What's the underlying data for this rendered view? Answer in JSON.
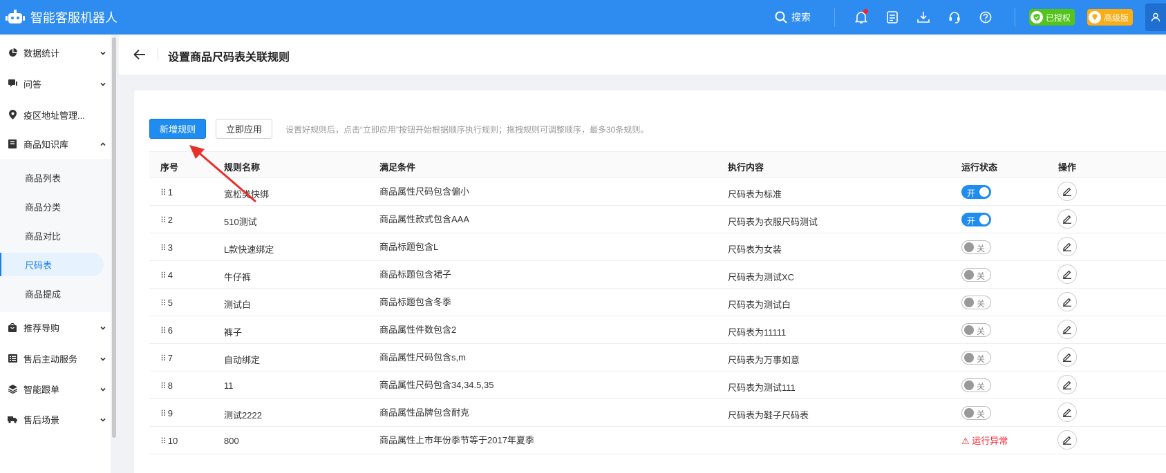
{
  "app": {
    "title": "智能客服机器人"
  },
  "topbar": {
    "search_label": "搜索",
    "authorized_label": "已授权",
    "edition_label": "高级版"
  },
  "sidebar": {
    "items": [
      {
        "label": "数据统计",
        "icon": "pie-chart-icon"
      },
      {
        "label": "问答",
        "icon": "chat-icon"
      },
      {
        "label": "疫区地址管理...",
        "icon": "location-icon"
      },
      {
        "label": "商品知识库",
        "icon": "book-icon"
      },
      {
        "label": "推荐导购",
        "icon": "bag-icon"
      },
      {
        "label": "售后主动服务",
        "icon": "list-icon"
      },
      {
        "label": "智能跟单",
        "icon": "layers-icon"
      },
      {
        "label": "售后场景",
        "icon": "truck-icon"
      }
    ],
    "sub_items": [
      {
        "label": "商品列表"
      },
      {
        "label": "商品分类"
      },
      {
        "label": "商品对比"
      },
      {
        "label": "尺码表"
      },
      {
        "label": "商品提成"
      }
    ],
    "active_sub": "尺码表"
  },
  "page": {
    "title": "设置商品尺码表关联规则",
    "add_button": "新增规则",
    "apply_button": "立即应用",
    "tip": "设置好规则后，点击“立即应用”按钮开始根据顺序执行规则；拖拽规则可调整顺序，最多30条规则。"
  },
  "table": {
    "columns": [
      "序号",
      "规则名称",
      "满足条件",
      "执行内容",
      "运行状态",
      "操作"
    ],
    "rows": [
      {
        "idx": "1",
        "name": "宽松类快绑",
        "cond": "商品属性尺码包含偏小",
        "exec": "尺码表为标准",
        "status": "开",
        "on": true
      },
      {
        "idx": "2",
        "name": "510测试",
        "cond": "商品属性款式包含AAA",
        "exec": "尺码表为衣服尺码测试",
        "status": "开",
        "on": true
      },
      {
        "idx": "3",
        "name": "L款快速绑定",
        "cond": "商品标题包含L",
        "exec": "尺码表为女装",
        "status": "关",
        "on": false
      },
      {
        "idx": "4",
        "name": "牛仔裤",
        "cond": "商品标题包含裙子",
        "exec": "尺码表为测试XC",
        "status": "关",
        "on": false
      },
      {
        "idx": "5",
        "name": "测试白",
        "cond": "商品标题包含冬季",
        "exec": "尺码表为测试白",
        "status": "关",
        "on": false
      },
      {
        "idx": "6",
        "name": "裤子",
        "cond": "商品属性件数包含2",
        "exec": "尺码表为11111",
        "status": "关",
        "on": false
      },
      {
        "idx": "7",
        "name": "自动绑定",
        "cond": "商品属性尺码包含s,m",
        "exec": "尺码表为万事如意",
        "status": "关",
        "on": false
      },
      {
        "idx": "8",
        "name": "11",
        "cond": "商品属性尺码包含34,34.5,35",
        "exec": "尺码表为测试111",
        "status": "关",
        "on": false
      },
      {
        "idx": "9",
        "name": "测试2222",
        "cond": "商品属性品牌包含耐克",
        "exec": "尺码表为鞋子尺码表",
        "status": "关",
        "on": false
      },
      {
        "idx": "10",
        "name": "800",
        "cond": "商品属性上市年份季节等于2017年夏季",
        "exec": "",
        "status": "运行异常",
        "on": null
      }
    ]
  },
  "colors": {
    "primary": "#1f8cf0",
    "topbar": "#2e8cf0",
    "active_bg": "#e6f3fe",
    "error": "#f5222d",
    "annotation": "#e8302a"
  }
}
